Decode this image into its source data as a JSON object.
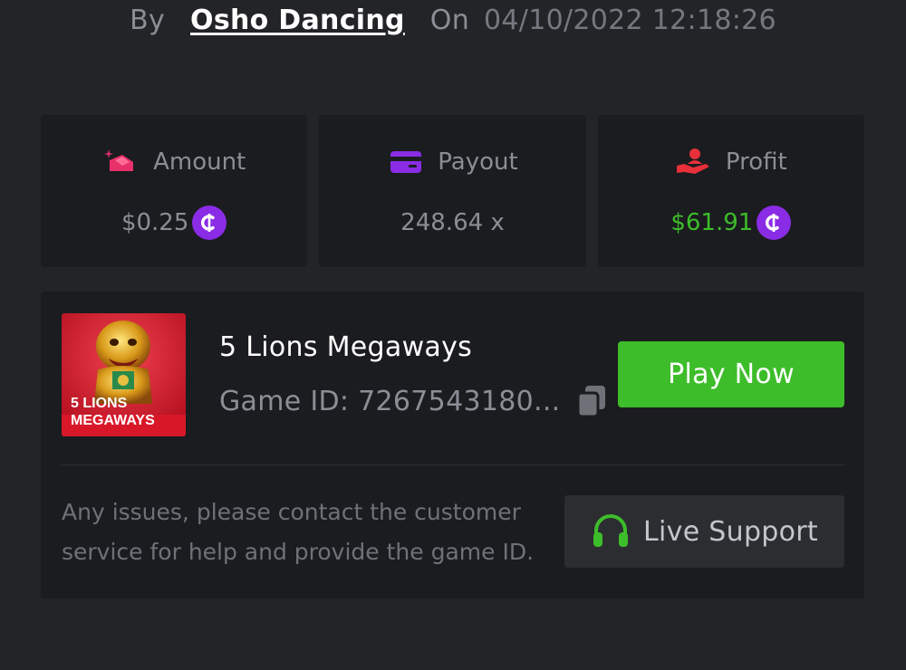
{
  "header": {
    "by_label": "By",
    "username": "Osho Dancing",
    "on_label": "On",
    "timestamp": "04/10/2022 12:18:26"
  },
  "stats": {
    "amount": {
      "label": "Amount",
      "value": "$0.25",
      "icon": "amount-icon",
      "color": "#e8306a"
    },
    "payout": {
      "label": "Payout",
      "value": "248.64 x",
      "icon": "card-icon",
      "color": "#8a2ce6"
    },
    "profit": {
      "label": "Profit",
      "value": "$61.91",
      "icon": "hand-user-icon",
      "color": "#e8303a",
      "value_color": "#3dbd2a"
    }
  },
  "currency": {
    "icon": "coin-icon",
    "color": "#8a2ce6"
  },
  "game": {
    "title": "5 Lions Megaways",
    "id_text": "Game ID: 7267543180...",
    "thumbnail_text_1": "5 LIONS",
    "thumbnail_text_2": "MEGAWAYS",
    "play_label": "Play Now"
  },
  "support": {
    "text": "Any issues, please contact the customer service for help and provide the game ID.",
    "button_label": "Live Support"
  },
  "colors": {
    "background": "#232428",
    "card": "#1b1c1f",
    "accent_green": "#3dbd2a",
    "muted_text": "#8a8e95"
  }
}
